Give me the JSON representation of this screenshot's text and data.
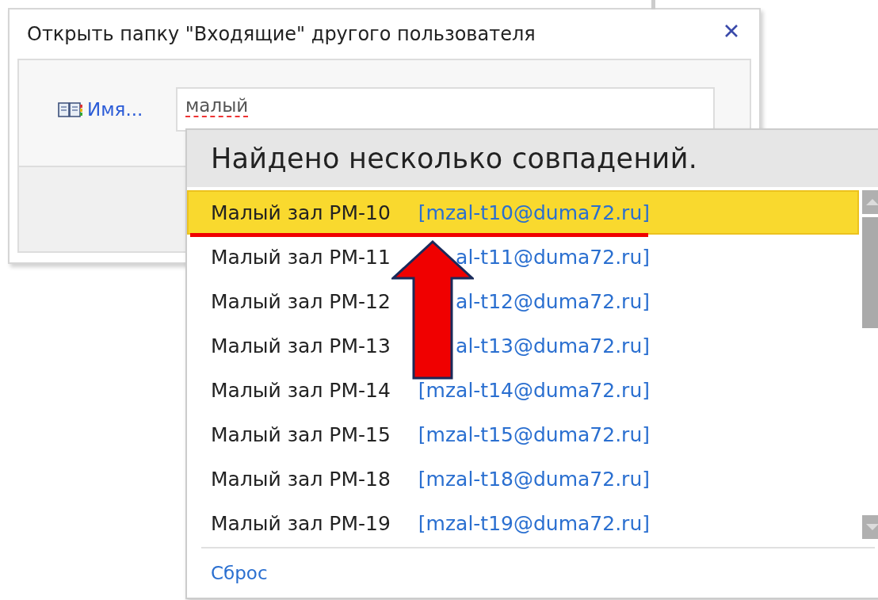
{
  "dialog": {
    "title": "Открыть папку \"Входящие\" другого пользователя",
    "name_button": "Имя...",
    "name_field": {
      "value": "малый"
    }
  },
  "suggestions": {
    "header": "Найдено несколько совпадений.",
    "items": [
      {
        "name": "Малый зал РМ-10",
        "email": "[mzal-t10@duma72.ru]",
        "selected": true
      },
      {
        "name": "Малый зал РМ-11",
        "email": "al-t11@duma72.ru]",
        "selected": false
      },
      {
        "name": "Малый зал РМ-12",
        "email": "al-t12@duma72.ru]",
        "selected": false
      },
      {
        "name": "Малый зал РМ-13",
        "email": "al-t13@duma72.ru]",
        "selected": false
      },
      {
        "name": "Малый зал РМ-14",
        "email": "[mzal-t14@duma72.ru]",
        "selected": false
      },
      {
        "name": "Малый зал РМ-15",
        "email": "[mzal-t15@duma72.ru]",
        "selected": false
      },
      {
        "name": "Малый зал РМ-18",
        "email": "[mzal-t18@duma72.ru]",
        "selected": false
      },
      {
        "name": "Малый зал РМ-19",
        "email": "[mzal-t19@duma72.ru]",
        "selected": false
      }
    ],
    "reset": "Сброс"
  }
}
